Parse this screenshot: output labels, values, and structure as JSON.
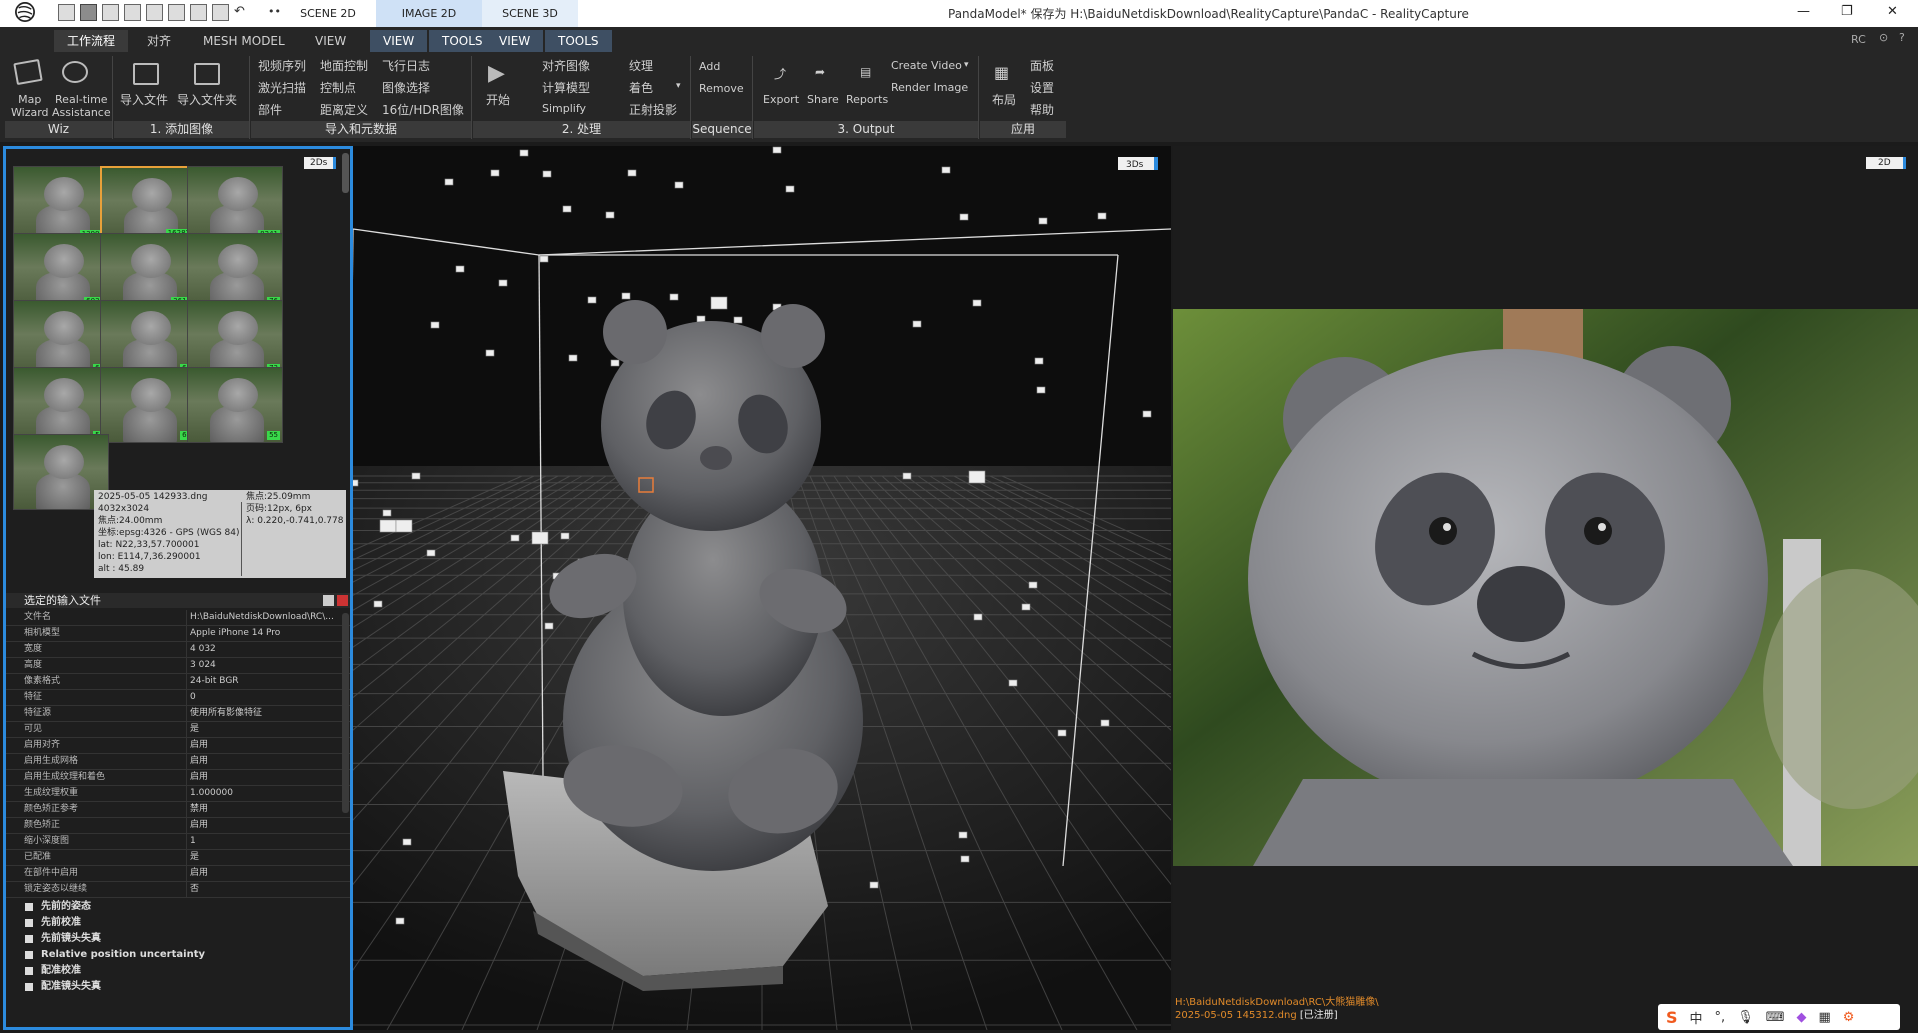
{
  "titlebar": {
    "doc_tabs": [
      "SCENE 2D",
      "IMAGE 2D",
      "SCENE 3D"
    ],
    "title": "PandaModel* 保存为 H:\\BaiduNetdiskDownload\\RealityCapture\\PandaC - RealityCapture",
    "dots": "••"
  },
  "ribbon": {
    "tabs": [
      "工作流程",
      "对齐",
      "MESH MODEL",
      "VIEW",
      "VIEW",
      "TOOLS",
      "VIEW",
      "TOOLS"
    ],
    "rc_label": "RC",
    "wiz": {
      "map_wizard": "Map\nWizard",
      "realtime": "Real-time\nAssistance"
    },
    "add": {
      "import_file": "导入文件",
      "import_folder": "导入文件夹"
    },
    "importmeta": [
      [
        "视频序列",
        "地面控制",
        "飞行日志"
      ],
      [
        "激光扫描",
        "控制点",
        "图像选择"
      ],
      [
        "部件",
        "距离定义",
        "16位/HDR图像"
      ]
    ],
    "process": {
      "start": "开始",
      "align": "对齐图像",
      "calc": "计算模型",
      "simplify": "Simplify",
      "texture": "纹理",
      "color": "着色",
      "ortho": "正射投影"
    },
    "sequence": {
      "add": "Add",
      "remove": "Remove"
    },
    "output": {
      "export": "Export",
      "share": "Share",
      "reports": "Reports",
      "create_video": "Create Video",
      "render_image": "Render Image"
    },
    "app": {
      "layout": "布局",
      "panel": "面板",
      "settings": "设置",
      "help": "帮助"
    },
    "groups": [
      "Wiz",
      "1. 添加图像",
      "导入和元数据",
      "2. 处理",
      "Sequence",
      "3. Output",
      "应用"
    ]
  },
  "thumbs": {
    "badge_label": "2Ds",
    "counts": [
      "13997",
      "16282",
      "8241",
      "6030",
      "3613",
      "76",
      "64",
      "68",
      "73",
      "53",
      "61",
      "55"
    ]
  },
  "tooltip": {
    "left": [
      "2025-05-05 142933.dng",
      "4032x3024",
      "焦点:24.00mm",
      "坐标:epsg:4326 - GPS (WGS 84)",
      "lat: N22,33,57.700001",
      "lon: E114,7,36.290001",
      "alt : 45.89"
    ],
    "right": [
      "焦点:25.09mm",
      "页码:12px, 6px",
      "λ: 0.220,-0.741,0.778"
    ]
  },
  "props": {
    "header": "选定的输入文件",
    "rows": [
      [
        "文件名",
        "H:\\BaiduNetdiskDownload\\RC\\..."
      ],
      [
        "相机模型",
        "Apple iPhone 14 Pro"
      ],
      [
        "宽度",
        "4 032"
      ],
      [
        "高度",
        "3 024"
      ],
      [
        "像素格式",
        "24-bit BGR"
      ],
      [
        "特征",
        "0"
      ],
      [
        "特征源",
        "使用所有影像特征"
      ],
      [
        "可见",
        "是"
      ],
      [
        "启用对齐",
        "启用"
      ],
      [
        "启用生成网格",
        "启用"
      ],
      [
        "启用生成纹理和着色",
        "启用"
      ],
      [
        "生成纹理权重",
        "1.000000"
      ],
      [
        "颜色矫正参考",
        "禁用"
      ],
      [
        "颜色矫正",
        "启用"
      ],
      [
        "缩小深度图",
        "1"
      ],
      [
        "已配准",
        "是"
      ],
      [
        "在部件中启用",
        "启用"
      ],
      [
        "锁定姿态以继续",
        "否"
      ]
    ],
    "sections": [
      "先前的姿态",
      "先前校准",
      "先前镜头失真",
      "Relative position uncertainty",
      "配准校准",
      "配准镜头失真"
    ]
  },
  "view3d": {
    "badge": "3Ds"
  },
  "view2d": {
    "badge": "2D",
    "path": "H:\\BaiduNetdiskDownload\\RC\\大熊猫雕像\\",
    "file": "2025-05-05 145312.dng",
    "registered": "[已注册]"
  },
  "ime": {
    "lang": "中"
  }
}
